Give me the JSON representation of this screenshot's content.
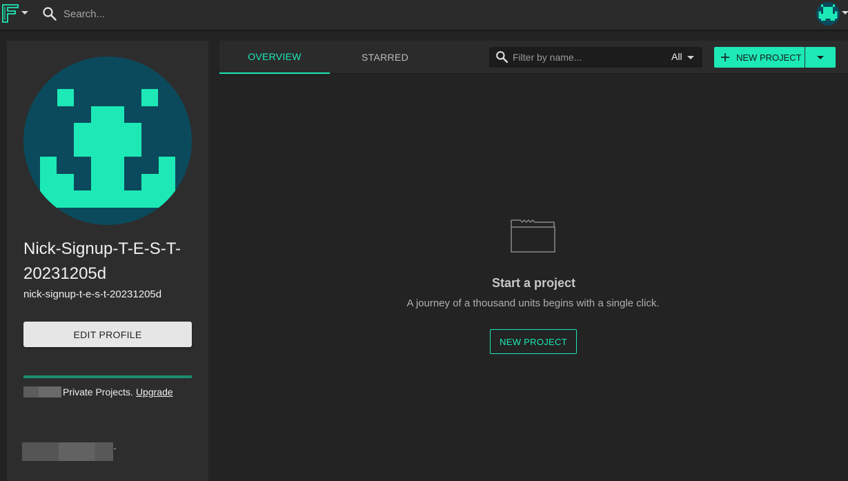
{
  "colors": {
    "accent": "#1de9b6",
    "avatar_bg": "#0b4a5c",
    "progress": "#1a8f6e"
  },
  "topbar": {
    "logo_icon": "fusion-logo-icon",
    "search_placeholder": "Search...",
    "search_icon": "search-icon",
    "avatar_icon": "space-invader-avatar-icon"
  },
  "sidebar": {
    "display_name": "Nick-Signup-T-E-S-T-20231205d",
    "username": "nick-signup-t-e-s-t-20231205d",
    "edit_profile_label": "EDIT PROFILE",
    "private_projects_text": "Private Projects.",
    "upgrade_label": "Upgrade",
    "private_projects_progress": 1.0
  },
  "main": {
    "tabs": [
      {
        "label": "OVERVIEW",
        "active": true
      },
      {
        "label": "STARRED",
        "active": false
      }
    ],
    "filter": {
      "placeholder": "Filter by name...",
      "selected": "All"
    },
    "new_project_label": "NEW PROJECT",
    "empty_state": {
      "icon": "folder-icon",
      "title": "Start a project",
      "subtitle": "A journey of a thousand units begins with a single click.",
      "button_label": "NEW PROJECT"
    }
  }
}
